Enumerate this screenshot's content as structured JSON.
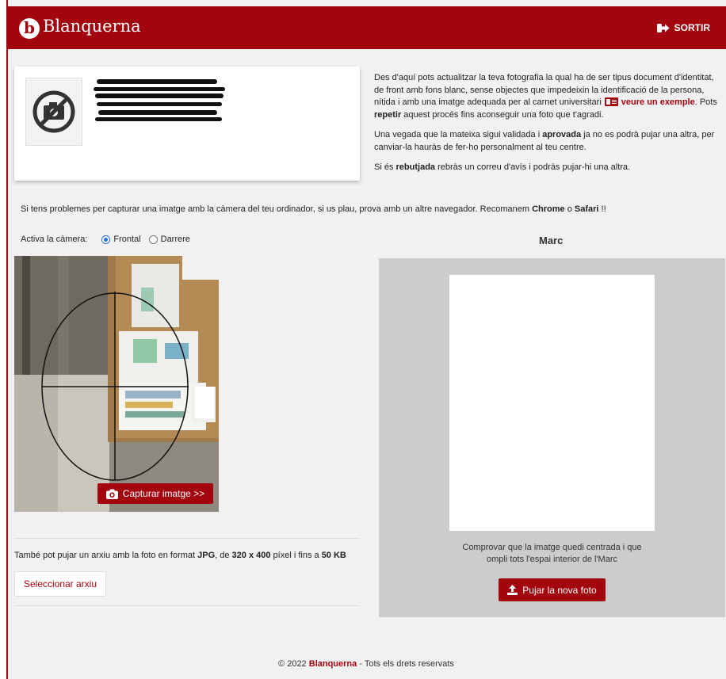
{
  "header": {
    "logo_letter": "b",
    "brand": "Blanquerna",
    "logout_label": "SORTIR"
  },
  "info": {
    "p1_a": "Des d'aquí pots actualitzar la teva fotografia la qual ha de ser tipus document d'identitat, de front amb fons blanc, sense objectes que impedeixin la identificació de la persona, nítida i amb una imatge adequada per al carnet universitari",
    "example_link": "veure un exemple",
    "p1_b": ". Pots",
    "repeat_bold": "repetir",
    "p1_c": " aquest procés fins aconseguir una foto que t'agradi.",
    "p2_a": "Una vegada que la mateixa sigui validada i ",
    "approved_bold": "aprovada",
    "p2_b": " ja no es podrà pujar una altra, per canviar-la hauràs de fer-ho personalment al teu centre.",
    "p3_a": "Si és ",
    "rejected_bold": "rebutjada",
    "p3_b": " rebràs un correu d'avís i podràs pujar-hi una altra."
  },
  "notice": {
    "text_a": "Si tens problemes per capturar una imatge amb la càmera del teu ordinador, si us plau, prova amb un altre navegador. Recomanem ",
    "chrome": "Chrome",
    "text_b": " o ",
    "safari": "Safari",
    "text_c": " !!"
  },
  "camera_select": {
    "label": "Activa la càmera:",
    "options": [
      "Frontal",
      "Darrere"
    ],
    "selected": "Frontal"
  },
  "capture_button": "Capturar imatge >>",
  "upload": {
    "text_a": "També pot pujar un arxiu amb la foto en format ",
    "format": "JPG",
    "text_b": ", de ",
    "dims": "320 x 400",
    "text_c": " píxel i fins a ",
    "size": "50 KB",
    "select_button": "Seleccionar arxiu"
  },
  "marc": {
    "title": "Marc",
    "caption_line1": "Comprovar que la imatge quedi centrada i que",
    "caption_line2": "ompli tots l'espai interior de l'Marc",
    "upload_button": "Pujar la nova foto"
  },
  "footer": {
    "copy": "© 2022 ",
    "brand": "Blanquerna",
    "rest": " - Tots els drets reservats"
  },
  "colors": {
    "brand": "#a3050f",
    "panel_gray": "#cccccc",
    "radio_blue": "#2a6fdb"
  }
}
